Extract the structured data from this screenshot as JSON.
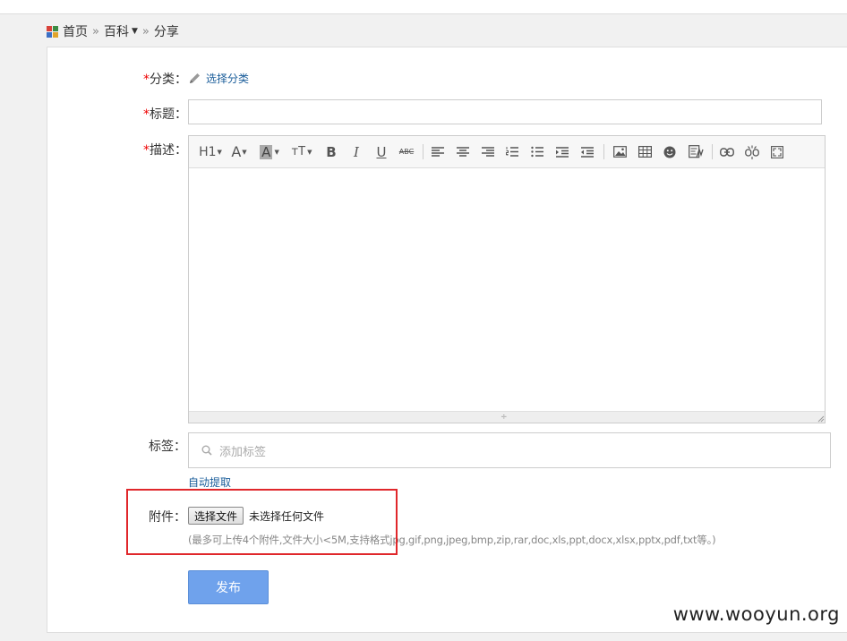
{
  "breadcrumb": {
    "home": "首页",
    "sep1": "»",
    "section": "百科",
    "sep2": "»",
    "current": "分享"
  },
  "form": {
    "required_mark": "*",
    "category": {
      "label": "分类：",
      "link": "选择分类"
    },
    "title": {
      "label": "标题：",
      "value": ""
    },
    "description": {
      "label": "描述："
    },
    "tags": {
      "label": "标签：",
      "placeholder": "添加标签",
      "auto_extract": "自动提取"
    },
    "attachment": {
      "label": "附件：",
      "button": "选择文件",
      "status": "未选择任何文件",
      "hint": "(最多可上传4个附件,文件大小<5M,支持格式jpg,gif,png,jpeg,bmp,zip,rar,doc,xls,ppt,docx,xlsx,pptx,pdf,txt等。)"
    },
    "submit": "发布"
  },
  "toolbar": {
    "heading": "H1",
    "font_size": "A",
    "highlight": "A",
    "case": "тT",
    "bold": "B",
    "italic": "I",
    "underline": "U",
    "strikethrough": "ABC"
  },
  "colors": {
    "accent": "#6fa2ec",
    "link": "#1a5d9a",
    "required": "#e00000",
    "highlight_box": "#e0272b"
  },
  "watermark": "www.wooyun.org"
}
